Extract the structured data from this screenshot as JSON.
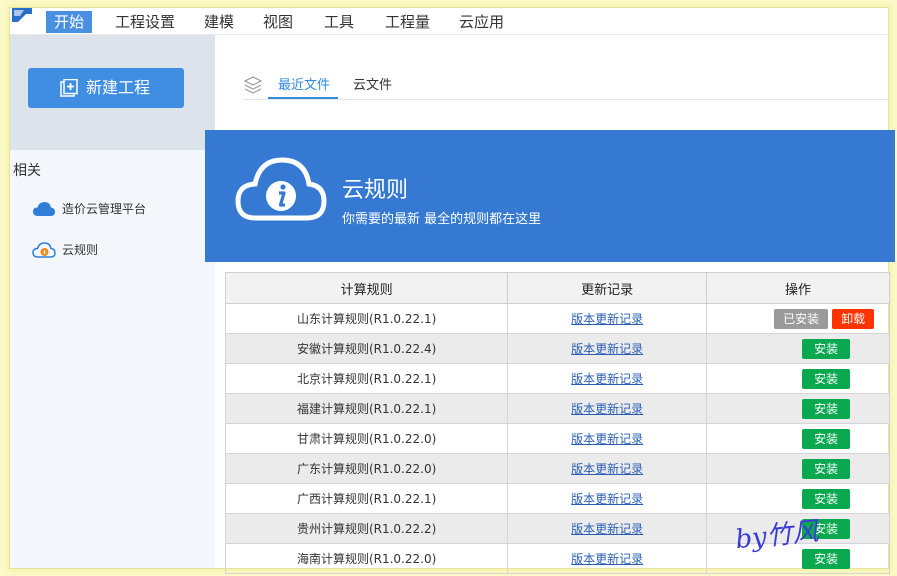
{
  "menu": {
    "items": [
      "开始",
      "工程设置",
      "建模",
      "视图",
      "工具",
      "工程量",
      "云应用"
    ],
    "active_index": 0
  },
  "sidebar": {
    "new_project_label": "新建工程",
    "section_title": "相关",
    "links": [
      {
        "label": "造价云管理平台",
        "icon": "cloud-icon"
      },
      {
        "label": "云规则",
        "icon": "cloud-info-icon"
      }
    ]
  },
  "main": {
    "tabs": [
      {
        "label": "最近文件",
        "active": true
      },
      {
        "label": "云文件",
        "active": false
      }
    ]
  },
  "banner": {
    "title": "云规则",
    "subtitle": "你需要的最新 最全的规则都在这里"
  },
  "table": {
    "headers": [
      "计算规则",
      "更新记录",
      "操作"
    ],
    "rows": [
      {
        "rule": "山东计算规则(R1.0.22.1)",
        "log": "版本更新记录",
        "installed": true
      },
      {
        "rule": "安徽计算规则(R1.0.22.4)",
        "log": "版本更新记录",
        "installed": false
      },
      {
        "rule": "北京计算规则(R1.0.22.1)",
        "log": "版本更新记录",
        "installed": false
      },
      {
        "rule": "福建计算规则(R1.0.22.1)",
        "log": "版本更新记录",
        "installed": false
      },
      {
        "rule": "甘肃计算规则(R1.0.22.0)",
        "log": "版本更新记录",
        "installed": false
      },
      {
        "rule": "广东计算规则(R1.0.22.0)",
        "log": "版本更新记录",
        "installed": false
      },
      {
        "rule": "广西计算规则(R1.0.22.1)",
        "log": "版本更新记录",
        "installed": false
      },
      {
        "rule": "贵州计算规则(R1.0.22.2)",
        "log": "版本更新记录",
        "installed": false
      },
      {
        "rule": "海南计算规则(R1.0.22.0)",
        "log": "版本更新记录",
        "installed": false
      }
    ],
    "installed_label": "已安装",
    "uninstall_label": "卸载",
    "install_label": "安装"
  },
  "watermark": "by竹风",
  "colors": {
    "accent": "#3579d2",
    "install_green": "#0aa84f",
    "uninstall_red": "#ff3300",
    "installed_gray": "#9a9a9a"
  }
}
